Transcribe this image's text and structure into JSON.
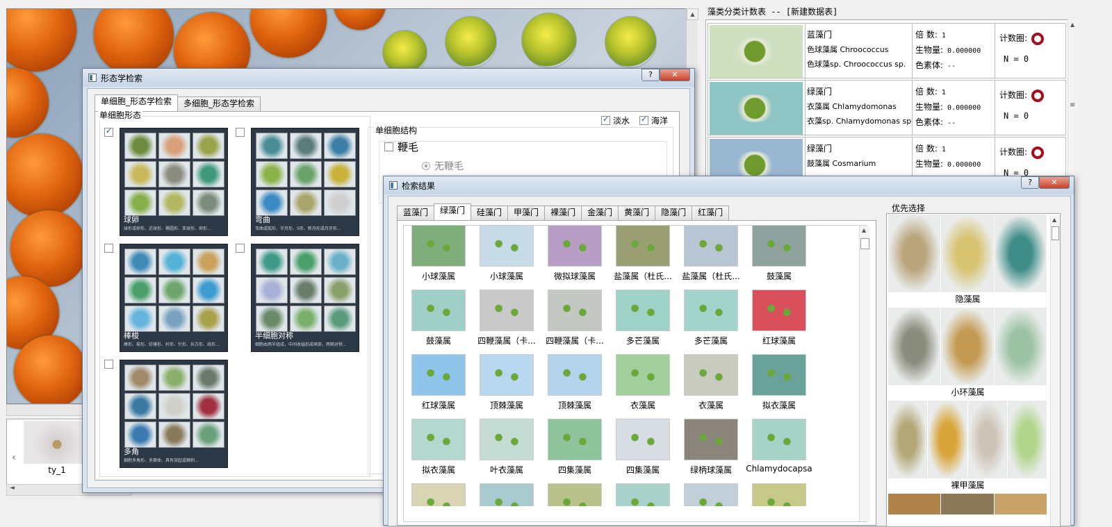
{
  "main_view": {
    "thumbnail_label": "ty_1"
  },
  "count_table": {
    "title": "藻类分类计数表 -- [新建数据表]",
    "rows": [
      {
        "phylum": "蓝藻门",
        "genus": "色球藻属 Chroococcus",
        "species": "色球藻sp. Chroococcus sp.",
        "times_label": "倍  数:",
        "times": "1",
        "biomass_label": "生物量:",
        "biomass": "0.000000",
        "pigment_label": "色素体:",
        "pigment": "--",
        "circle_label": "计数圈:",
        "n_label": "N  = 0",
        "thumb_color": "#cfe0c0"
      },
      {
        "phylum": "绿藻门",
        "genus": "衣藻属 Chlamydomonas",
        "species": "衣藻sp. Chlamydomonas sp.",
        "times_label": "倍  数:",
        "times": "1",
        "biomass_label": "生物量:",
        "biomass": "0.000000",
        "pigment_label": "色素体:",
        "pigment": "--",
        "circle_label": "计数圈:",
        "n_label": "N  = 0",
        "thumb_color": "#8fc4c4"
      },
      {
        "phylum": "绿藻门",
        "genus": "鼓藻属 Cosmarium",
        "species": "",
        "times_label": "倍  数:",
        "times": "1",
        "biomass_label": "生物量:",
        "biomass": "0.000000",
        "pigment_label": "",
        "pigment": "",
        "circle_label": "计数圈:",
        "n_label": "N  = 0",
        "thumb_color": "#9ab7d2"
      }
    ]
  },
  "morph_dialog": {
    "title": "形态学检索",
    "help": "?",
    "close": "✕",
    "tabs": [
      "单细胞_形态学检索",
      "多细胞_形态学检索"
    ],
    "group_label": "单细胞形态",
    "freshwater": "淡水",
    "marine": "海洋",
    "structure_label": "单细胞结构",
    "flagella_label": "鞭毛",
    "no_flagella": "无鞭毛",
    "morphs": [
      {
        "label": "球卵",
        "desc": "球形或卵形、近球形、椭圆形、亚球形、卵形..."
      },
      {
        "label": "弯曲",
        "desc": "弯曲或弧形、半月形、S形、新月形或月牙形..."
      },
      {
        "label": "棒梭",
        "desc": "棒形、梭形、纺锤形、杆形、针形、长方形、线形..."
      },
      {
        "label": "半细胞对称",
        "desc": "细胞由两半组成，中间收缢形成峡部，两侧对称..."
      },
      {
        "label": "多角",
        "desc": "细胞多角形、多面体、具有突起或棘刺..."
      }
    ]
  },
  "results_dialog": {
    "title": "检索结果",
    "help": "?",
    "close": "✕",
    "tabs": [
      "蓝藻门",
      "绿藻门",
      "硅藻门",
      "甲藻门",
      "裸藻门",
      "金藻门",
      "黄藻门",
      "隐藻门",
      "红藻门"
    ],
    "items": [
      {
        "label": "小球藻属",
        "color": "#7fae7a"
      },
      {
        "label": "小球藻属",
        "color": "#c7dbe8"
      },
      {
        "label": "微拟球藻属",
        "color": "#b89ec4"
      },
      {
        "label": "盐藻属（杜氏...",
        "color": "#9a9f73"
      },
      {
        "label": "盐藻属（杜氏...",
        "color": "#b7c6d2"
      },
      {
        "label": "鼓藻属",
        "color": "#8fa29e"
      },
      {
        "label": "鼓藻属",
        "color": "#9fcfc6"
      },
      {
        "label": "四鞭藻属（卡...",
        "color": "#c9c9c9"
      },
      {
        "label": "四鞭藻属（卡...",
        "color": "#c3c8c2"
      },
      {
        "label": "多芒藻属",
        "color": "#9fd2c7"
      },
      {
        "label": "多芒藻属",
        "color": "#a3d4cb"
      },
      {
        "label": "红球藻属",
        "color": "#d9505c"
      },
      {
        "label": "红球藻属",
        "color": "#8fc5ea"
      },
      {
        "label": "顶棘藻属",
        "color": "#b9d8ef"
      },
      {
        "label": "顶棘藻属",
        "color": "#b4d3ec"
      },
      {
        "label": "衣藻属",
        "color": "#a3cf9f"
      },
      {
        "label": "衣藻属",
        "color": "#c9cbbf"
      },
      {
        "label": "拟衣藻属",
        "color": "#6aa29a"
      },
      {
        "label": "拟衣藻属",
        "color": "#b3d8cf"
      },
      {
        "label": "叶衣藻属",
        "color": "#c4dcd3"
      },
      {
        "label": "四集藻属",
        "color": "#8fc39c"
      },
      {
        "label": "四集藻属",
        "color": "#d7dde3"
      },
      {
        "label": "绿柄球藻属",
        "color": "#8a857a"
      },
      {
        "label": "Chlamydocapsa",
        "color": "#a7d2c7"
      },
      {
        "label": "",
        "color": "#d8d4b4"
      },
      {
        "label": "",
        "color": "#a9cbcf"
      },
      {
        "label": "",
        "color": "#b9c28b"
      },
      {
        "label": "",
        "color": "#a8d1c9"
      },
      {
        "label": "",
        "color": "#c3cfd8"
      },
      {
        "label": "",
        "color": "#c7c98a"
      }
    ],
    "priority_label": "优先选择",
    "priority_groups": [
      {
        "label": "隐藻属",
        "colors": [
          "#b9a47c",
          "#d7c370",
          "#3f8d89"
        ]
      },
      {
        "label": "小环藻属",
        "colors": [
          "#8a8c7d",
          "#c49a52",
          "#9cc2a4"
        ]
      },
      {
        "label": "裸甲藻属",
        "colors": [
          "#b3a778",
          "#d9a53a",
          "#cfc4b8",
          "#b0d48a"
        ]
      }
    ]
  }
}
